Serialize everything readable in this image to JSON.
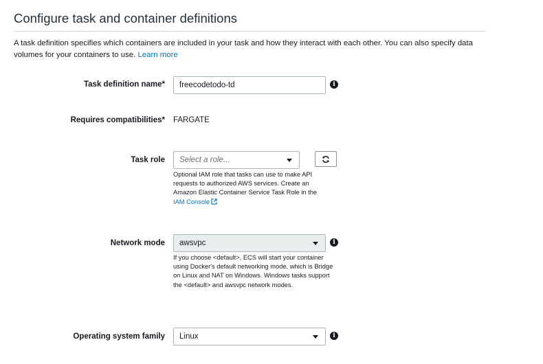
{
  "section": {
    "title": "Configure task and container definitions",
    "description": "A task definition specifies which containers are included in your task and how they interact with each other. You can also specify data volumes for your containers to use.",
    "learn_more": "Learn more"
  },
  "fields": {
    "task_definition_name": {
      "label": "Task definition name*",
      "value": "freecodetodo-td"
    },
    "requires_compatibilities": {
      "label": "Requires compatibilities*",
      "value": "FARGATE"
    },
    "task_role": {
      "label": "Task role",
      "placeholder": "Select a role...",
      "help": "Optional IAM role that tasks can use to make API requests to authorized AWS services. Create an Amazon Elastic Container Service Task Role in the",
      "help_link": "IAM Console"
    },
    "network_mode": {
      "label": "Network mode",
      "value": "awsvpc",
      "help": "If you choose <default>, ECS will start your container using Docker's default networking mode, which is Bridge on Linux and NAT on Windows. Windows tasks support the <default> and awsvpc network modes."
    },
    "os_family": {
      "label": "Operating system family",
      "value": "Linux"
    }
  },
  "icons": {
    "info": "info-icon",
    "refresh": "refresh-icon",
    "external_link": "external-link-icon",
    "dropdown": "caret-down-icon"
  },
  "colors": {
    "link": "#0073bb",
    "text": "#16191f",
    "border": "#aab7b8",
    "disabled_bg": "#eaeded"
  }
}
